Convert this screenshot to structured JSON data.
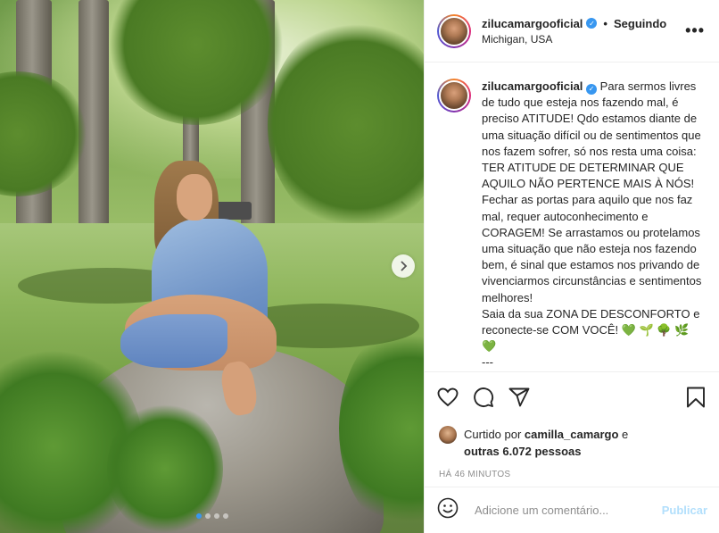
{
  "post": {
    "username": "zilucamargooficial",
    "following_label": "Seguindo",
    "location": "Michigan, USA",
    "more_label": "•••"
  },
  "caption": {
    "username": "zilucamargooficial",
    "text": "Para sermos livres de tudo que esteja nos fazendo mal, é preciso ATITUDE! Qdo estamos diante de uma situação difícil ou de sentimentos que nos fazem sofrer, só nos resta uma coisa: TER ATITUDE DE DETERMINAR QUE AQUILO NÃO PERTENCE MAIS À NÓS! Fechar as portas para aquilo que nos faz mal, requer autoconhecimento e CORAGEM! Se arrastamos ou protelamos uma situação que não esteja nos fazendo bem, é sinal que estamos nos privando de vivenciarmos circunstâncias e sentimentos melhores!\nSaia da sua ZONA DE DESCONFORTO e reconecte-se COM VOCÊ! ",
    "emojis": "💚 🌱 🌳 🌿\n💚",
    "tail": "---"
  },
  "likes": {
    "prefix": "Curtido por ",
    "user": "camilla_camargo",
    "middle": " e",
    "others": "outras 6.072 pessoas"
  },
  "timestamp": "HÁ 46 MINUTOS",
  "comment": {
    "placeholder": "Adicione um comentário...",
    "publish_label": "Publicar"
  },
  "carousel": {
    "slide_count": 4,
    "active_index": 0
  },
  "icons": [
    "heart-icon",
    "comment-icon",
    "share-icon",
    "bookmark-icon",
    "smile-icon",
    "chevron-right-icon",
    "verified-icon"
  ],
  "colors": {
    "verified": "#3897f0",
    "publish": "#b2dffc",
    "timestamp": "#8e8e8e",
    "dot_active": "#3897f0"
  }
}
